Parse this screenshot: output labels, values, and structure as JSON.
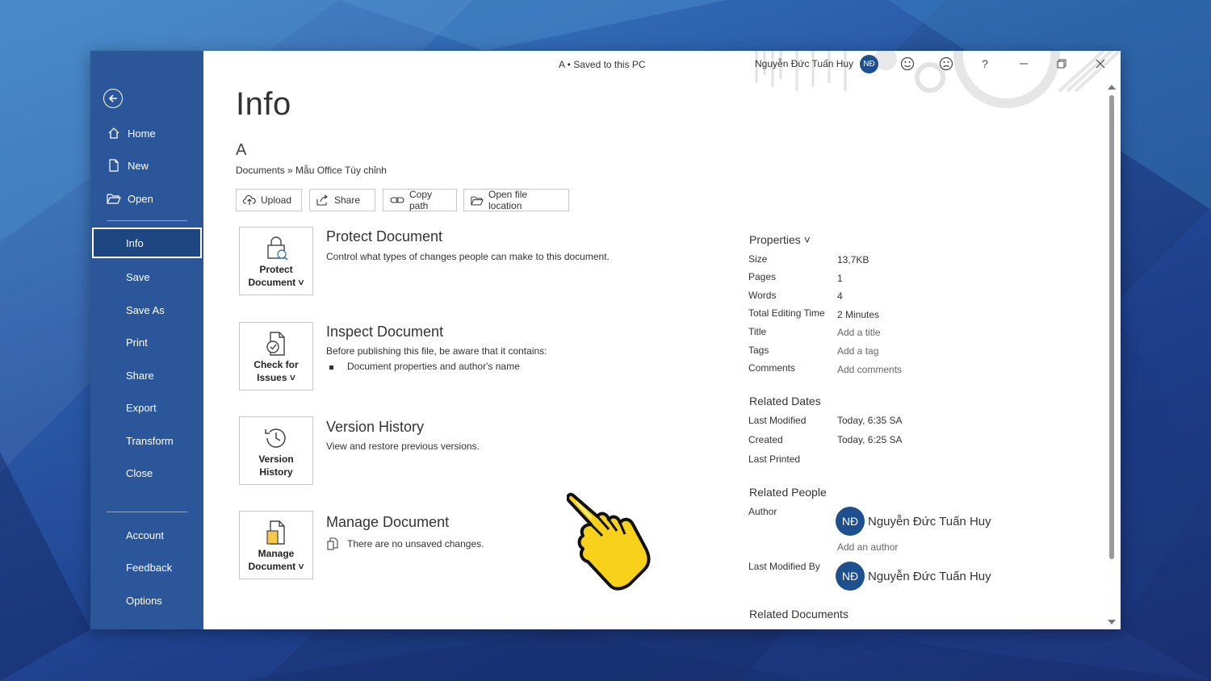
{
  "titlebar": {
    "doc_status": "A • Saved to this PC",
    "user_name": "Nguyễn Đức Tuấn Huy",
    "user_initials": "NĐ",
    "help": "?"
  },
  "sidebar": {
    "items": [
      {
        "label": "Home",
        "icon": "home-icon"
      },
      {
        "label": "New",
        "icon": "new-document-icon"
      },
      {
        "label": "Open",
        "icon": "folder-open-icon"
      },
      {
        "label": "Info"
      },
      {
        "label": "Save"
      },
      {
        "label": "Save As"
      },
      {
        "label": "Print"
      },
      {
        "label": "Share"
      },
      {
        "label": "Export"
      },
      {
        "label": "Transform"
      },
      {
        "label": "Close"
      },
      {
        "label": "Account"
      },
      {
        "label": "Feedback"
      },
      {
        "label": "Options"
      }
    ],
    "active": "Info",
    "color": "#2b579a"
  },
  "main": {
    "title": "Info",
    "doc_name": "A",
    "breadcrumb": "Documents » Mẫu Office Tùy chỉnh",
    "actions": {
      "upload": "Upload",
      "share": "Share",
      "copy_path": "Copy path",
      "open_location": "Open file location"
    },
    "sections": {
      "protect": {
        "tile_line1": "Protect",
        "tile_line2": "Document ˅",
        "title": "Protect Document",
        "desc": "Control what types of changes people can make to this document."
      },
      "inspect": {
        "tile_line1": "Check for",
        "tile_line2": "Issues ˅",
        "title": "Inspect Document",
        "desc": "Before publishing this file, be aware that it contains:",
        "bullet": "Document properties and author's name"
      },
      "version": {
        "tile_line1": "Version",
        "tile_line2": "History",
        "title": "Version History",
        "desc": "View and restore previous versions."
      },
      "manage": {
        "tile_line1": "Manage",
        "tile_line2": "Document ˅",
        "title": "Manage Document",
        "desc": "There are no unsaved changes."
      }
    }
  },
  "properties": {
    "header": "Properties ˅",
    "rows": [
      {
        "key": "Size",
        "value": "13,7KB"
      },
      {
        "key": "Pages",
        "value": "1"
      },
      {
        "key": "Words",
        "value": "4"
      },
      {
        "key": "Total Editing Time",
        "value": "2 Minutes"
      },
      {
        "key": "Title",
        "value": "Add a title"
      },
      {
        "key": "Tags",
        "value": "Add a tag"
      },
      {
        "key": "Comments",
        "value": "Add comments"
      }
    ],
    "related_dates": {
      "header": "Related Dates",
      "rows": [
        {
          "key": "Last Modified",
          "value": "Today, 6:35 SA"
        },
        {
          "key": "Created",
          "value": "Today, 6:25 SA"
        },
        {
          "key": "Last Printed",
          "value": ""
        }
      ]
    },
    "related_people": {
      "header": "Related People",
      "author_label": "Author",
      "author_initials": "NĐ",
      "author_name": "Nguyễn Đức Tuấn Huy",
      "add_author": "Add an author",
      "last_modified_label": "Last Modified By",
      "last_modified_initials": "NĐ",
      "last_modified_name": "Nguyễn Đức Tuấn Huy"
    },
    "related_documents": {
      "header": "Related Documents"
    }
  }
}
